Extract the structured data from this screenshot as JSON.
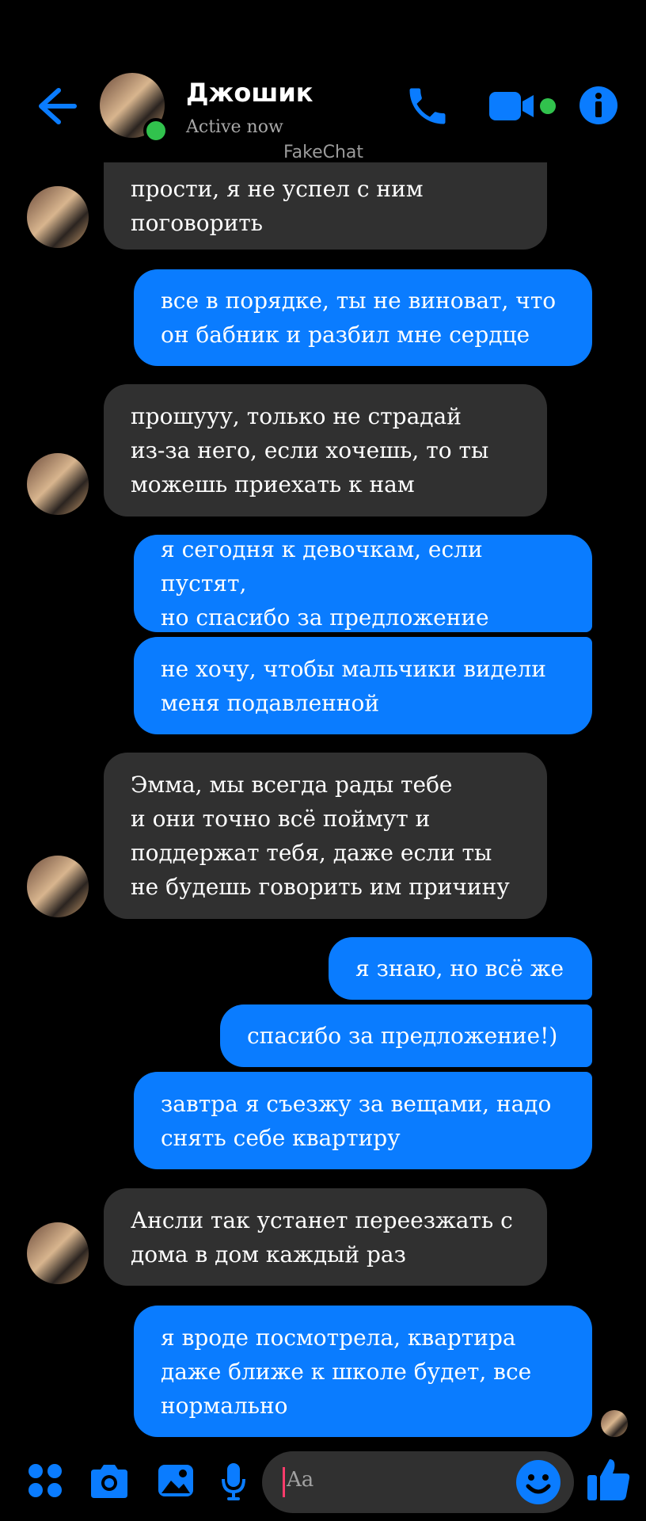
{
  "header": {
    "name": "Джошик",
    "status": "Active now",
    "watermark": "FakeChat"
  },
  "messages": [
    {
      "side": "in",
      "text": "прости, я не успел с ним\nпоговорить"
    },
    {
      "side": "out",
      "text": "все в порядке, ты не виноват, что\nон бабник и разбил мне сердце"
    },
    {
      "side": "in",
      "text": "прошууу, только не страдай\nиз-за него, если хочешь, то ты\nможешь приехать к нам"
    },
    {
      "side": "out",
      "text": "я сегодня к девочкам, если пустят,\nно спасибо за предложение"
    },
    {
      "side": "out",
      "text": "не хочу, чтобы мальчики видели\nменя подавленной"
    },
    {
      "side": "in",
      "text": "Эмма, мы всегда рады тебе\nи они точно всё поймут и\nподдержат тебя, даже если ты\nне будешь говорить им причину"
    },
    {
      "side": "out",
      "text": "я знаю, но всё же"
    },
    {
      "side": "out",
      "text": "спасибо за предложение!)"
    },
    {
      "side": "out",
      "text": "завтра я съезжу за вещами, надо\nснять себе квартиру"
    },
    {
      "side": "in",
      "text": "Ансли так устанет переезжать с\nдома в дом каждый раз"
    },
    {
      "side": "out",
      "text": "я вроде посмотрела, квартира\nдаже ближе к школе будет, все\nнормально"
    }
  ],
  "composer": {
    "placeholder": "Aa"
  },
  "icons": {
    "back": "arrow-left-icon",
    "call": "phone-icon",
    "video": "video-camera-icon",
    "info": "info-icon",
    "menu": "apps-grid-icon",
    "camera": "camera-icon",
    "gallery": "image-icon",
    "mic": "microphone-icon",
    "emoji": "smile-icon",
    "like": "thumbs-up-icon"
  },
  "colors": {
    "accent": "#0a7cff",
    "incoming_bubble": "#303030",
    "online": "#31c24d",
    "background": "#000000"
  }
}
